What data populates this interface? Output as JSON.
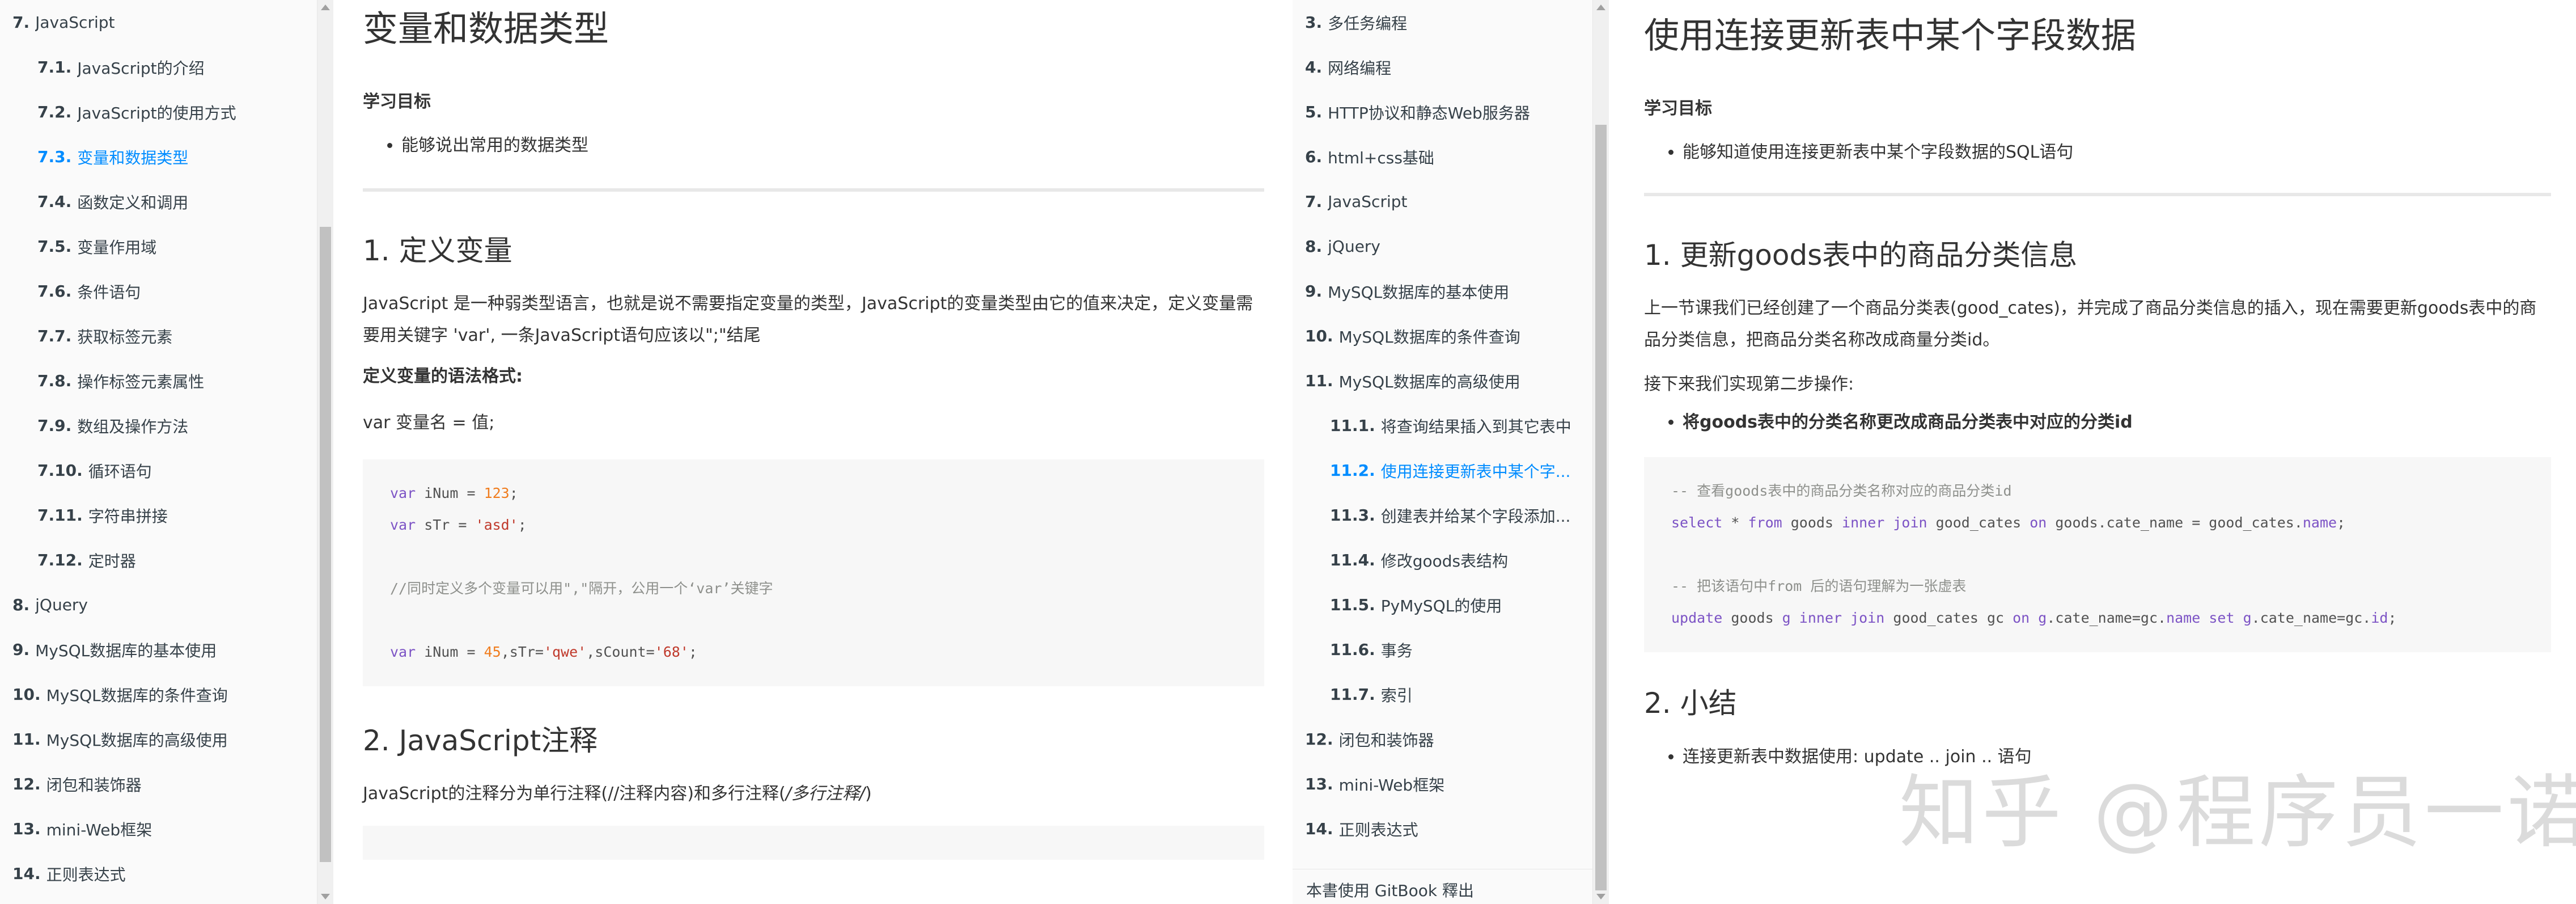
{
  "left_sidebar": {
    "items": [
      {
        "num": "7.",
        "label": "JavaScript",
        "level": 1,
        "active": false
      },
      {
        "num": "7.1.",
        "label": "JavaScript的介绍",
        "level": 2,
        "active": false
      },
      {
        "num": "7.2.",
        "label": "JavaScript的使用方式",
        "level": 2,
        "active": false
      },
      {
        "num": "7.3.",
        "label": "变量和数据类型",
        "level": 2,
        "active": true
      },
      {
        "num": "7.4.",
        "label": "函数定义和调用",
        "level": 2,
        "active": false
      },
      {
        "num": "7.5.",
        "label": "变量作用域",
        "level": 2,
        "active": false
      },
      {
        "num": "7.6.",
        "label": "条件语句",
        "level": 2,
        "active": false
      },
      {
        "num": "7.7.",
        "label": "获取标签元素",
        "level": 2,
        "active": false
      },
      {
        "num": "7.8.",
        "label": "操作标签元素属性",
        "level": 2,
        "active": false
      },
      {
        "num": "7.9.",
        "label": "数组及操作方法",
        "level": 2,
        "active": false
      },
      {
        "num": "7.10.",
        "label": "循环语句",
        "level": 2,
        "active": false
      },
      {
        "num": "7.11.",
        "label": "字符串拼接",
        "level": 2,
        "active": false
      },
      {
        "num": "7.12.",
        "label": "定时器",
        "level": 2,
        "active": false
      },
      {
        "num": "8.",
        "label": "jQuery",
        "level": 1,
        "active": false
      },
      {
        "num": "9.",
        "label": "MySQL数据库的基本使用",
        "level": 1,
        "active": false
      },
      {
        "num": "10.",
        "label": "MySQL数据库的条件查询",
        "level": 1,
        "active": false
      },
      {
        "num": "11.",
        "label": "MySQL数据库的高级使用",
        "level": 1,
        "active": false
      },
      {
        "num": "12.",
        "label": "闭包和装饰器",
        "level": 1,
        "active": false
      },
      {
        "num": "13.",
        "label": "mini-Web框架",
        "level": 1,
        "active": false
      },
      {
        "num": "14.",
        "label": "正则表达式",
        "level": 1,
        "active": false
      }
    ]
  },
  "left_content": {
    "title": "变量和数据类型",
    "goals_label": "学习目标",
    "goals": [
      "能够说出常用的数据类型"
    ],
    "section1_title": "1. 定义变量",
    "section1_para": "JavaScript 是一种弱类型语言，也就是说不需要指定变量的类型，JavaScript的变量类型由它的值来决定，定义变量需要用关键字 'var', 一条JavaScript语句应该以\";\"结尾",
    "syntax_label": "定义变量的语法格式:",
    "syntax_line": "var 变量名 = 值;",
    "code": {
      "l1_kw": "var",
      "l1_rest": " iNum = ",
      "l1_num": "123",
      "l1_end": ";",
      "l2_kw": "var",
      "l2_rest": " sTr = ",
      "l2_str": "'asd'",
      "l2_end": ";",
      "l3_comment": "//同时定义多个变量可以用\",\"隔开，公用一个‘var’关键字",
      "l4_kw": "var",
      "l4_a": " iNum = ",
      "l4_num": "45",
      "l4_b": ",sTr=",
      "l4_str1": "'qwe'",
      "l4_c": ",sCount=",
      "l4_str2": "'68'",
      "l4_end": ";"
    },
    "section2_title": "2. JavaScript注释",
    "section2_para_a": "JavaScript的注释分为单行注释(//注释内容)和多行注释(",
    "section2_para_em": "/多行注释/",
    "section2_para_b": ")"
  },
  "right_sidebar": {
    "items": [
      {
        "num": "3.",
        "label": "多任务编程",
        "level": 1,
        "active": false
      },
      {
        "num": "4.",
        "label": "网络编程",
        "level": 1,
        "active": false
      },
      {
        "num": "5.",
        "label": "HTTP协议和静态Web服务器",
        "level": 1,
        "active": false
      },
      {
        "num": "6.",
        "label": "html+css基础",
        "level": 1,
        "active": false
      },
      {
        "num": "7.",
        "label": "JavaScript",
        "level": 1,
        "active": false
      },
      {
        "num": "8.",
        "label": "jQuery",
        "level": 1,
        "active": false
      },
      {
        "num": "9.",
        "label": "MySQL数据库的基本使用",
        "level": 1,
        "active": false
      },
      {
        "num": "10.",
        "label": "MySQL数据库的条件查询",
        "level": 1,
        "active": false
      },
      {
        "num": "11.",
        "label": "MySQL数据库的高级使用",
        "level": 1,
        "active": false
      },
      {
        "num": "11.1.",
        "label": "将查询结果插入到其它表中",
        "level": 2,
        "active": false
      },
      {
        "num": "11.2.",
        "label": "使用连接更新表中某个字...",
        "level": 2,
        "active": true
      },
      {
        "num": "11.3.",
        "label": "创建表并给某个字段添加...",
        "level": 2,
        "active": false
      },
      {
        "num": "11.4.",
        "label": "修改goods表结构",
        "level": 2,
        "active": false
      },
      {
        "num": "11.5.",
        "label": "PyMySQL的使用",
        "level": 2,
        "active": false
      },
      {
        "num": "11.6.",
        "label": "事务",
        "level": 2,
        "active": false
      },
      {
        "num": "11.7.",
        "label": "索引",
        "level": 2,
        "active": false
      },
      {
        "num": "12.",
        "label": "闭包和装饰器",
        "level": 1,
        "active": false
      },
      {
        "num": "13.",
        "label": "mini-Web框架",
        "level": 1,
        "active": false
      },
      {
        "num": "14.",
        "label": "正则表达式",
        "level": 1,
        "active": false
      }
    ],
    "gitbook_label": "本書使用 GitBook 釋出"
  },
  "right_content": {
    "title": "使用连接更新表中某个字段数据",
    "goals_label": "学习目标",
    "goals": [
      "能够知道使用连接更新表中某个字段数据的SQL语句"
    ],
    "section1_title": "1. 更新goods表中的商品分类信息",
    "section1_para": "上一节课我们已经创建了一个商品分类表(good_cates)，并完成了商品分类信息的插入，现在需要更新goods表中的商品分类信息，把商品分类名称改成商量分类id。",
    "next_para": "接下来我们实现第二步操作:",
    "bullet_bold": "将goods表中的分类名称更改成商品分类表中对应的分类id",
    "code": {
      "c1": "-- 查看goods表中的商品分类名称对应的商品分类id",
      "l2_select": "select",
      "l2_a": " * ",
      "l2_from": "from",
      "l2_b": " goods ",
      "l2_inner": "inner",
      "l2_c": " ",
      "l2_join": "join",
      "l2_d": " good_cates ",
      "l2_on": "on",
      "l2_e": " goods.cate_name = good_cates.",
      "l2_name": "name",
      "l2_end": ";",
      "c2": "-- 把该语句中from 后的语句理解为一张虚表",
      "l4_update": "update",
      "l4_a": " goods ",
      "l4_g1": "g",
      "l4_b": " ",
      "l4_inner": "inner",
      "l4_c": " ",
      "l4_join": "join",
      "l4_d": " good_cates gc ",
      "l4_on": "on",
      "l4_e": " ",
      "l4_g2": "g",
      "l4_f": ".cate_name=gc.",
      "l4_name": "name",
      "l4_g": " ",
      "l4_set": "set",
      "l4_h": " ",
      "l4_g3": "g",
      "l4_i": ".cate_name=gc.",
      "l4_id": "id",
      "l4_end": ";"
    },
    "section2_title": "2. 小结",
    "summary_a": "连接更新表中数据使用: ",
    "summary_b": "update .. join .. 语句"
  },
  "watermark": "知乎 @程序员一诺",
  "colors": {
    "link_active": "#008cff",
    "sidebar_bg": "#fafafa",
    "code_bg": "#f7f7f7"
  }
}
